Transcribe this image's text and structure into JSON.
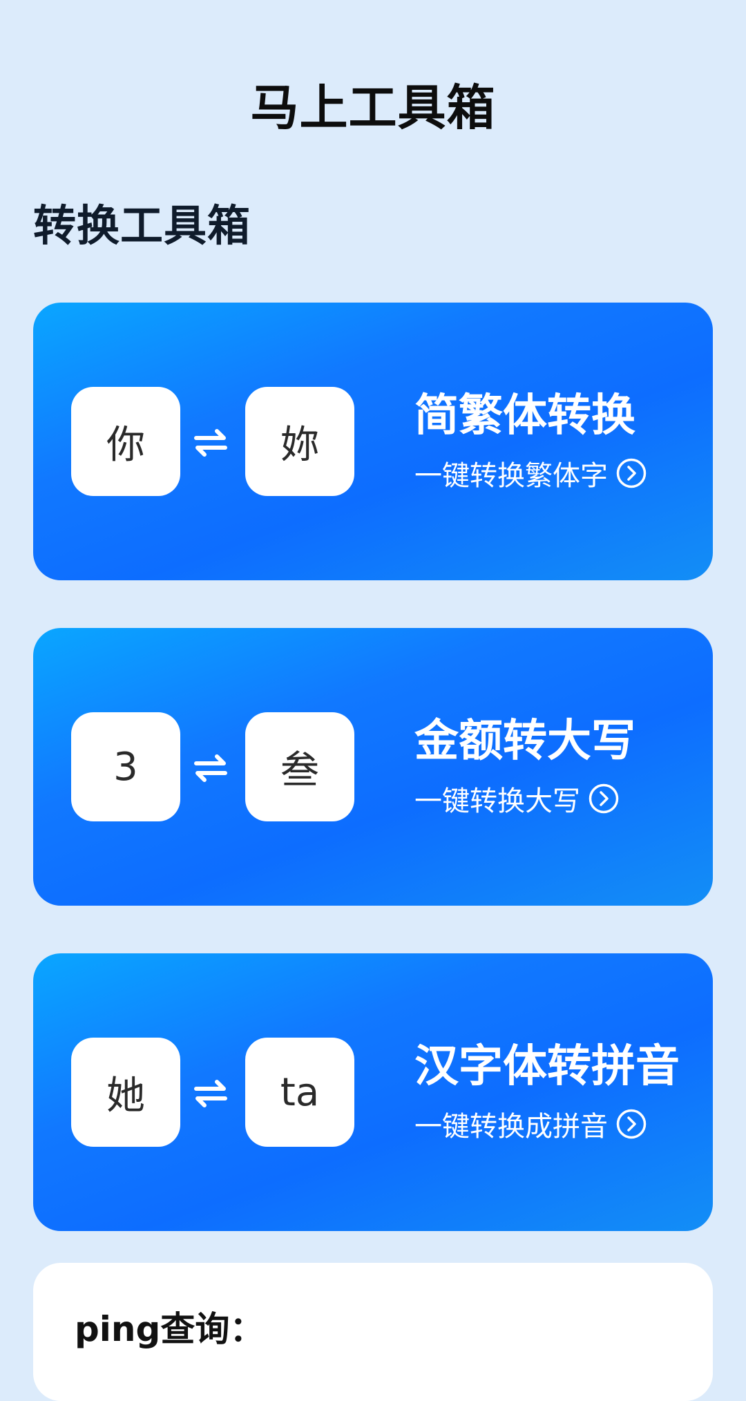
{
  "header": {
    "title": "马上工具箱"
  },
  "section": {
    "title": "转换工具箱"
  },
  "cards": [
    {
      "left_char": "你",
      "right_char": "妳",
      "title": "简繁体转换",
      "subtitle": "一键转换繁体字"
    },
    {
      "left_char": "3",
      "right_char": "叁",
      "title": "金额转大写",
      "subtitle": "一键转换大写"
    },
    {
      "left_char": "她",
      "right_char": "ta",
      "title": "汉字体转拼音",
      "subtitle": "一键转换成拼音"
    }
  ],
  "ping": {
    "label": "ping查询："
  },
  "icons": {
    "swap": "swap-arrows-icon",
    "go": "chevron-right-circle-icon"
  },
  "colors": {
    "background": "#dcebfb",
    "card_gradient_start": "#0aa6ff",
    "card_gradient_end": "#0d6dff",
    "white": "#ffffff"
  }
}
